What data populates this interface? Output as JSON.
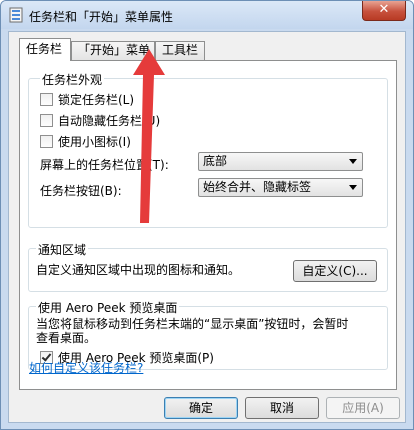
{
  "window": {
    "title": "任务栏和「开始」菜单属性",
    "close_label": "✕"
  },
  "tabs": [
    {
      "label": "任务栏",
      "active": true
    },
    {
      "label": "「开始」菜单",
      "active": false
    },
    {
      "label": "工具栏",
      "active": false
    }
  ],
  "appearance": {
    "title": "任务栏外观",
    "lock": {
      "label": "锁定任务栏(L)",
      "checked": false
    },
    "autohide": {
      "label": "自动隐藏任务栏(U)",
      "checked": false
    },
    "small_icons": {
      "label": "使用小图标(I)",
      "checked": false
    },
    "location_label": "屏幕上的任务栏位置(T):",
    "location_value": "底部",
    "buttons_label": "任务栏按钮(B):",
    "buttons_value": "始终合并、隐藏标签"
  },
  "notification": {
    "title": "通知区域",
    "description": "自定义通知区域中出现的图标和通知。",
    "customize_button": "自定义(C)..."
  },
  "aero_peek": {
    "title": "使用 Aero Peek 预览桌面",
    "description_line1": "当您将鼠标移动到任务栏末端的“显示桌面”按钮时，会暂时",
    "description_line2": "查看桌面。",
    "checkbox": {
      "label": "使用 Aero Peek 预览桌面(P)",
      "checked": true
    }
  },
  "help_link": "如何自定义该任务栏?",
  "buttons": {
    "ok": "确定",
    "cancel": "取消",
    "apply": "应用(A)"
  },
  "colors": {
    "annotation_arrow": "#e53b3b",
    "link": "#0066cc"
  }
}
